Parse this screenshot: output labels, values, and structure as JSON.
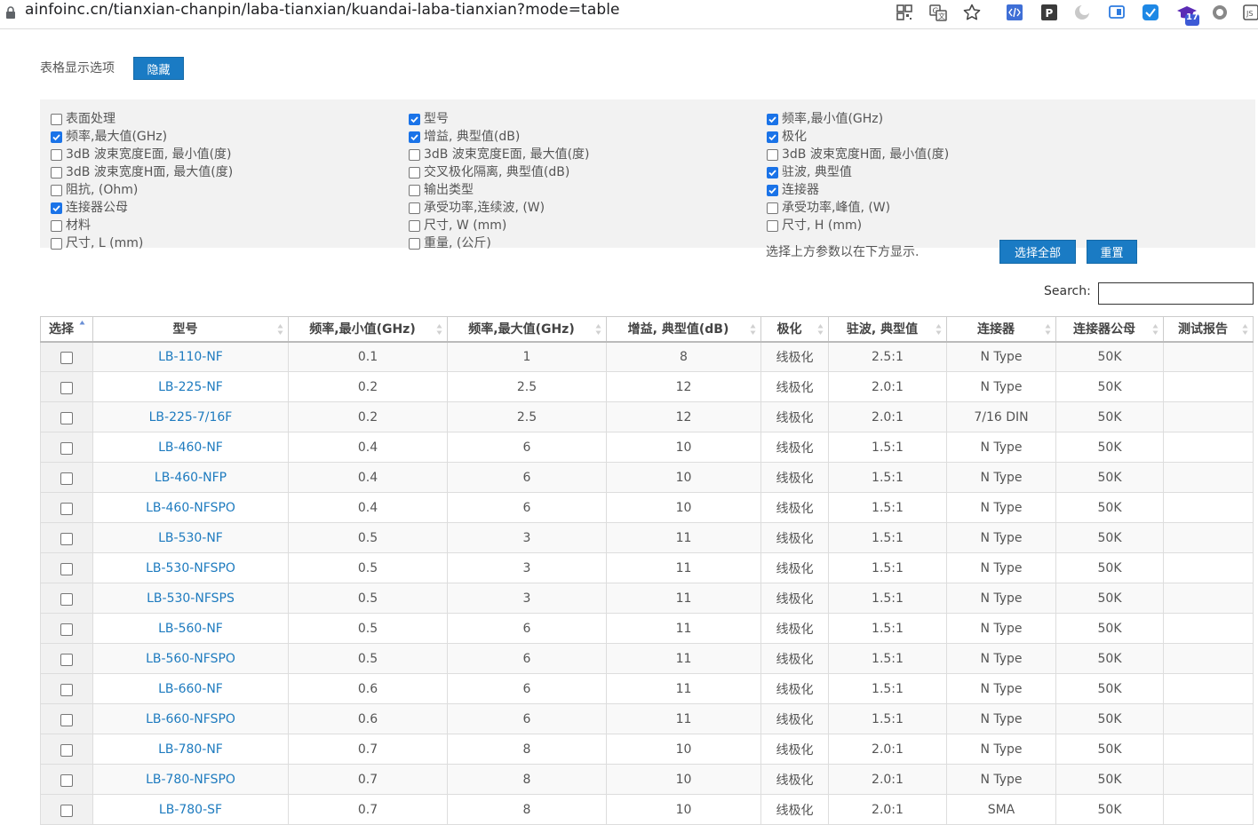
{
  "browser": {
    "url": "ainfoinc.cn/tianxian-chanpin/laba-tianxian/kuandai-laba-tianxian?mode=table",
    "ext_badge": "17"
  },
  "options": {
    "title": "表格显示选项",
    "hide_label": "隐藏",
    "columns": [
      [
        {
          "label": "表面处理",
          "checked": false
        },
        {
          "label": "频率,最大值(GHz)",
          "checked": true
        },
        {
          "label": "3dB 波束宽度E面, 最小值(度)",
          "checked": false
        },
        {
          "label": "3dB 波束宽度H面, 最大值(度)",
          "checked": false
        },
        {
          "label": "阻抗, (Ohm)",
          "checked": false
        },
        {
          "label": "连接器公母",
          "checked": true
        },
        {
          "label": "材料",
          "checked": false
        },
        {
          "label": "尺寸, L (mm)",
          "checked": false
        }
      ],
      [
        {
          "label": "型号",
          "checked": true
        },
        {
          "label": "增益, 典型值(dB)",
          "checked": true
        },
        {
          "label": "3dB 波束宽度E面, 最大值(度)",
          "checked": false
        },
        {
          "label": "交叉极化隔离, 典型值(dB)",
          "checked": false
        },
        {
          "label": "输出类型",
          "checked": false
        },
        {
          "label": "承受功率,连续波, (W)",
          "checked": false
        },
        {
          "label": "尺寸, W (mm)",
          "checked": false
        },
        {
          "label": "重量, (公斤)",
          "checked": false
        }
      ],
      [
        {
          "label": "频率,最小值(GHz)",
          "checked": true
        },
        {
          "label": "极化",
          "checked": true
        },
        {
          "label": "3dB 波束宽度H面, 最小值(度)",
          "checked": false
        },
        {
          "label": "驻波, 典型值",
          "checked": true
        },
        {
          "label": "连接器",
          "checked": true
        },
        {
          "label": "承受功率,峰值, (W)",
          "checked": false
        },
        {
          "label": "尺寸, H (mm)",
          "checked": false
        }
      ]
    ],
    "note": "选择上方参数以在下方显示.",
    "select_all_label": "选择全部",
    "reset_label": "重置"
  },
  "search": {
    "label": "Search:",
    "value": ""
  },
  "table": {
    "headers": [
      "选择",
      "型号",
      "频率,最小值(GHz)",
      "频率,最大值(GHz)",
      "增益, 典型值(dB)",
      "极化",
      "驻波, 典型值",
      "连接器",
      "连接器公母",
      "测试报告"
    ],
    "rows": [
      [
        "LB-110-NF",
        "0.1",
        "1",
        "8",
        "线极化",
        "2.5:1",
        "N Type",
        "50K",
        ""
      ],
      [
        "LB-225-NF",
        "0.2",
        "2.5",
        "12",
        "线极化",
        "2.0:1",
        "N Type",
        "50K",
        ""
      ],
      [
        "LB-225-7/16F",
        "0.2",
        "2.5",
        "12",
        "线极化",
        "2.0:1",
        "7/16 DIN",
        "50K",
        ""
      ],
      [
        "LB-460-NF",
        "0.4",
        "6",
        "10",
        "线极化",
        "1.5:1",
        "N Type",
        "50K",
        ""
      ],
      [
        "LB-460-NFP",
        "0.4",
        "6",
        "10",
        "线极化",
        "1.5:1",
        "N Type",
        "50K",
        ""
      ],
      [
        "LB-460-NFSPO",
        "0.4",
        "6",
        "10",
        "线极化",
        "1.5:1",
        "N Type",
        "50K",
        ""
      ],
      [
        "LB-530-NF",
        "0.5",
        "3",
        "11",
        "线极化",
        "1.5:1",
        "N Type",
        "50K",
        ""
      ],
      [
        "LB-530-NFSPO",
        "0.5",
        "3",
        "11",
        "线极化",
        "1.5:1",
        "N Type",
        "50K",
        ""
      ],
      [
        "LB-530-NFSPS",
        "0.5",
        "3",
        "11",
        "线极化",
        "1.5:1",
        "N Type",
        "50K",
        ""
      ],
      [
        "LB-560-NF",
        "0.5",
        "6",
        "11",
        "线极化",
        "1.5:1",
        "N Type",
        "50K",
        ""
      ],
      [
        "LB-560-NFSPO",
        "0.5",
        "6",
        "11",
        "线极化",
        "1.5:1",
        "N Type",
        "50K",
        ""
      ],
      [
        "LB-660-NF",
        "0.6",
        "6",
        "11",
        "线极化",
        "1.5:1",
        "N Type",
        "50K",
        ""
      ],
      [
        "LB-660-NFSPO",
        "0.6",
        "6",
        "11",
        "线极化",
        "1.5:1",
        "N Type",
        "50K",
        ""
      ],
      [
        "LB-780-NF",
        "0.7",
        "8",
        "10",
        "线极化",
        "2.0:1",
        "N Type",
        "50K",
        ""
      ],
      [
        "LB-780-NFSPO",
        "0.7",
        "8",
        "10",
        "线极化",
        "2.0:1",
        "N Type",
        "50K",
        ""
      ],
      [
        "LB-780-SF",
        "0.7",
        "8",
        "10",
        "线极化",
        "2.0:1",
        "SMA",
        "50K",
        ""
      ]
    ]
  }
}
